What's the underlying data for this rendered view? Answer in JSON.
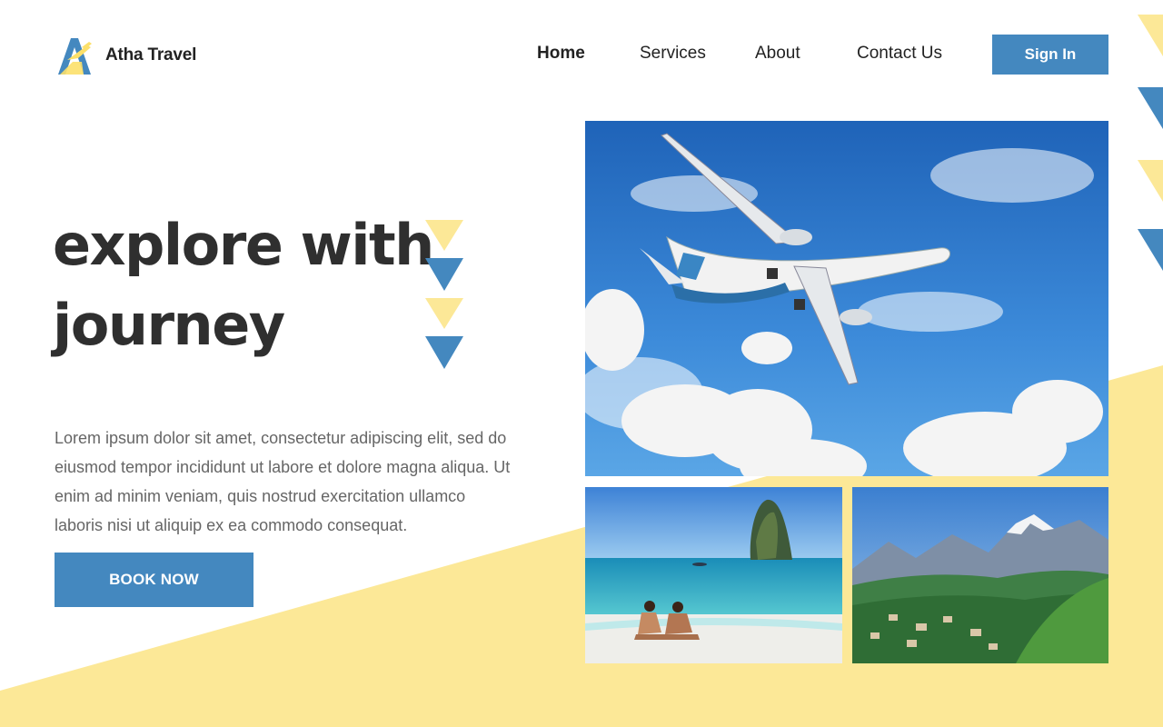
{
  "brand": {
    "name": "Atha Travel",
    "logo_icon": "plane-a-logo-icon"
  },
  "nav": {
    "items": [
      {
        "label": "Home",
        "active": true
      },
      {
        "label": "Services",
        "active": false
      },
      {
        "label": "About",
        "active": false
      },
      {
        "label": "Contact Us",
        "active": false
      }
    ],
    "signin_label": "Sign In"
  },
  "hero": {
    "title_line1": "explore with",
    "title_line2": "journey",
    "description": "Lorem ipsum dolor sit amet, consectetur adipiscing elit, sed do eiusmod tempor incididunt ut labore et dolore magna aliqua. Ut enim ad minim veniam, quis nostrud exercitation ullamco laboris nisi ut aliquip ex ea commodo consequat.",
    "cta_label": "BOOK NOW"
  },
  "gallery": [
    {
      "subject": "airplane in blue sky"
    },
    {
      "subject": "couple on tropical beach"
    },
    {
      "subject": "alpine mountain village"
    }
  ],
  "colors": {
    "accent_blue": "#4488bf",
    "accent_yellow": "#fce897",
    "text_dark": "#2f2f2f",
    "text_muted": "#666666"
  }
}
